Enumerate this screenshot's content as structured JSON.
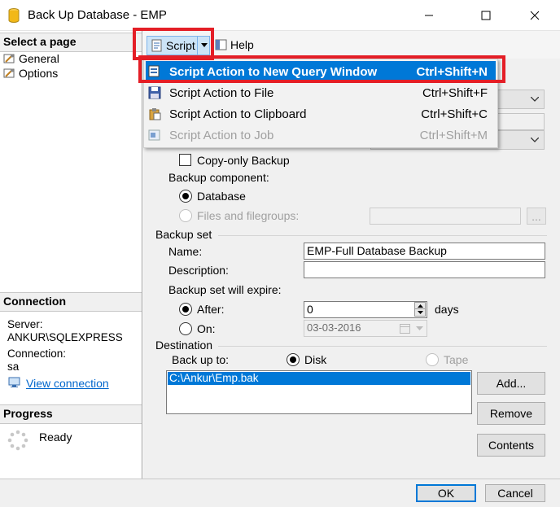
{
  "window": {
    "title": "Back Up Database - EMP"
  },
  "left": {
    "select_page_heading": "Select a page",
    "pages": [
      {
        "label": "General"
      },
      {
        "label": "Options"
      }
    ],
    "connection_heading": "Connection",
    "server_label": "Server:",
    "server_value": "ANKUR\\SQLEXPRESS",
    "connection_label": "Connection:",
    "connection_value": "sa",
    "view_connection_link": "View connection",
    "progress_heading": "Progress",
    "progress_status": "Ready"
  },
  "toolbar": {
    "script_label": "Script",
    "help_label": "Help"
  },
  "script_menu": {
    "items": [
      {
        "label": "Script Action to New Query Window",
        "shortcut": "Ctrl+Shift+N",
        "highlighted": true,
        "enabled": true
      },
      {
        "label": "Script Action to File",
        "shortcut": "Ctrl+Shift+F",
        "enabled": true
      },
      {
        "label": "Script Action to Clipboard",
        "shortcut": "Ctrl+Shift+C",
        "enabled": true
      },
      {
        "label": "Script Action to Job",
        "shortcut": "Ctrl+Shift+M",
        "enabled": false
      }
    ]
  },
  "form": {
    "copy_only_label": "Copy-only Backup",
    "copy_only_checked": false,
    "backup_component_label": "Backup component:",
    "component_database": "Database",
    "component_files": "Files and filegroups:",
    "browse_label": "...",
    "backup_set_heading": "Backup set",
    "name_label": "Name:",
    "name_value": "EMP-Full Database Backup",
    "description_label": "Description:",
    "description_value": "",
    "expire_label": "Backup set will expire:",
    "after_label": "After:",
    "after_value": "0",
    "days_label": "days",
    "on_label": "On:",
    "on_value": "03-03-2016",
    "destination_heading": "Destination",
    "back_up_to_label": "Back up to:",
    "disk_label": "Disk",
    "tape_label": "Tape",
    "destinations": [
      "C:\\Ankur\\Emp.bak"
    ],
    "add_button": "Add...",
    "remove_button": "Remove",
    "contents_button": "Contents"
  },
  "footer": {
    "ok_button": "OK",
    "cancel_button": "Cancel"
  },
  "colors": {
    "highlight": "#0078d7",
    "annotation_red": "#e41e26",
    "link_blue": "#0066cc"
  }
}
